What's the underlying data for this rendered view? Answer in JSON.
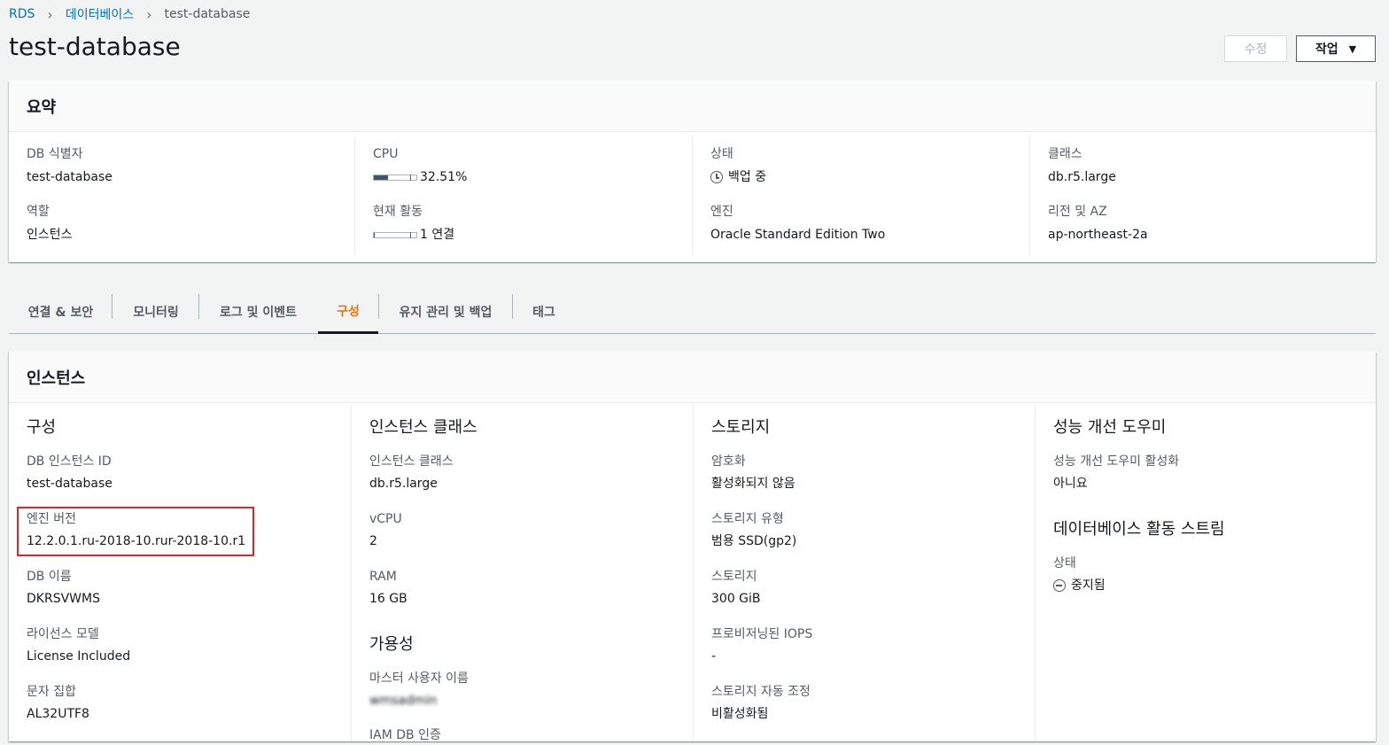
{
  "breadcrumb": {
    "items": [
      "RDS",
      "데이터베이스",
      "test-database"
    ]
  },
  "page": {
    "title": "test-database"
  },
  "toolbar": {
    "edit_label": "수정",
    "action_label": "작업"
  },
  "summary": {
    "title": "요약",
    "columns": [
      {
        "fields": [
          {
            "label": "DB 식별자",
            "value": "test-database"
          },
          {
            "label": "역할",
            "value": "인스턴스"
          }
        ]
      },
      {
        "fields": [
          {
            "label": "CPU",
            "value": "32.51%",
            "fill": 0.3251
          },
          {
            "label": "현재 활동",
            "value": "1 연결",
            "fill": 0.02
          }
        ]
      },
      {
        "fields": [
          {
            "label": "상태",
            "value": "백업 중",
            "icon": "clock-icon"
          },
          {
            "label": "엔진",
            "value": "Oracle Standard Edition Two"
          }
        ]
      },
      {
        "fields": [
          {
            "label": "클래스",
            "value": "db.r5.large"
          },
          {
            "label": "리전 및 AZ",
            "value": "ap-northeast-2a"
          }
        ]
      }
    ]
  },
  "tabs": [
    {
      "label": "연결 & 보안",
      "active": false
    },
    {
      "label": "모니터링",
      "active": false
    },
    {
      "label": "로그 및 이벤트",
      "active": false
    },
    {
      "label": "구성",
      "active": true
    },
    {
      "label": "유지 관리 및 백업",
      "active": false
    },
    {
      "label": "태그",
      "active": false
    }
  ],
  "instance": {
    "title": "인스턴스",
    "config": {
      "title": "구성",
      "fields": [
        {
          "label": "DB 인스턴스 ID",
          "value": "test-database"
        },
        {
          "label": "엔진 버전",
          "value": "12.2.0.1.ru-2018-10.rur-2018-10.r1"
        },
        {
          "label": "DB 이름",
          "value": "DKRSVWMS"
        },
        {
          "label": "라이선스 모델",
          "value": "License Included"
        },
        {
          "label": "문자 집합",
          "value": "AL32UTF8"
        }
      ]
    },
    "instance_class": {
      "title": "인스턴스 클래스",
      "fields": [
        {
          "label": "인스턴스 클래스",
          "value": "db.r5.large"
        },
        {
          "label": "vCPU",
          "value": "2"
        },
        {
          "label": "RAM",
          "value": "16 GB"
        }
      ]
    },
    "availability": {
      "title": "가용성",
      "fields": [
        {
          "label": "마스터 사용자 이름",
          "value": "wmsadmin"
        },
        {
          "label": "IAM DB 인증",
          "value": ""
        }
      ]
    },
    "storage": {
      "title": "스토리지",
      "fields": [
        {
          "label": "암호화",
          "value": "활성화되지 않음"
        },
        {
          "label": "스토리지 유형",
          "value": "범용 SSD(gp2)"
        },
        {
          "label": "스토리지",
          "value": "300 GiB"
        },
        {
          "label": "프로비저닝된 IOPS",
          "value": "-"
        },
        {
          "label": "스토리지 자동 조정",
          "value": "비활성화됨"
        }
      ]
    },
    "perf": {
      "title": "성능 개선 도우미",
      "fields": [
        {
          "label": "성능 개선 도우미 활성화",
          "value": "아니요"
        }
      ]
    },
    "stream": {
      "title": "데이터베이스 활동 스트림",
      "fields": [
        {
          "label": "상태",
          "value": "중지됨",
          "icon": "stop-icon"
        }
      ]
    }
  },
  "colors": {
    "link": "#0073bb",
    "active_tab": "#ec7211",
    "highlight": "#e0242c",
    "bar_fill": "#44546a"
  }
}
